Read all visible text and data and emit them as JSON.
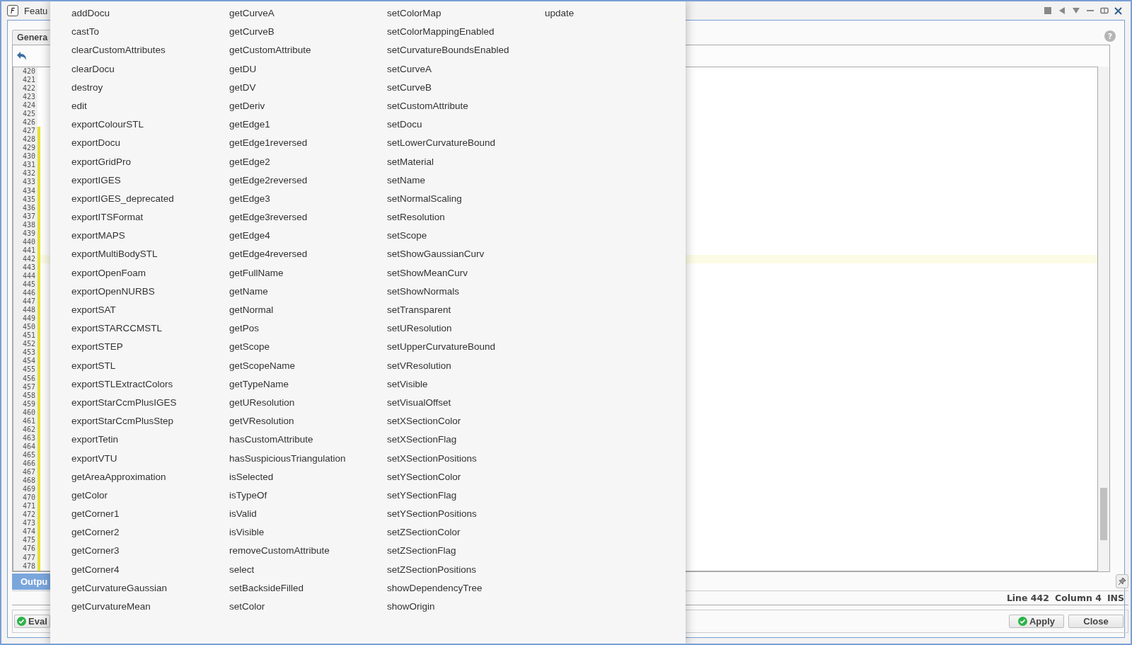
{
  "window": {
    "icon_letter": "F",
    "title": "Featu"
  },
  "tabs": [
    {
      "label": "Genera",
      "selected": true
    }
  ],
  "help": {
    "glyph": "?"
  },
  "editor": {
    "lines": [
      {
        "number": "420",
        "modified": false,
        "current": false
      },
      {
        "number": "421",
        "modified": false,
        "current": false
      },
      {
        "number": "422",
        "modified": false,
        "current": false
      },
      {
        "number": "423",
        "modified": false,
        "current": false
      },
      {
        "number": "424",
        "modified": false,
        "current": false
      },
      {
        "number": "425",
        "modified": false,
        "current": false
      },
      {
        "number": "426",
        "modified": false,
        "current": false
      },
      {
        "number": "427",
        "modified": true,
        "current": false
      },
      {
        "number": "428",
        "modified": true,
        "current": false
      },
      {
        "number": "429",
        "modified": true,
        "current": false
      },
      {
        "number": "430",
        "modified": true,
        "current": false
      },
      {
        "number": "431",
        "modified": true,
        "current": false
      },
      {
        "number": "432",
        "modified": true,
        "current": false
      },
      {
        "number": "433",
        "modified": true,
        "current": false
      },
      {
        "number": "434",
        "modified": true,
        "current": false
      },
      {
        "number": "435",
        "modified": true,
        "current": false
      },
      {
        "number": "436",
        "modified": true,
        "current": false
      },
      {
        "number": "437",
        "modified": true,
        "current": false
      },
      {
        "number": "438",
        "modified": true,
        "current": false
      },
      {
        "number": "439",
        "modified": true,
        "current": false
      },
      {
        "number": "440",
        "modified": true,
        "current": false
      },
      {
        "number": "441",
        "modified": true,
        "current": false
      },
      {
        "number": "442",
        "modified": true,
        "current": true
      },
      {
        "number": "443",
        "modified": true,
        "current": false
      },
      {
        "number": "444",
        "modified": true,
        "current": false
      },
      {
        "number": "445",
        "modified": true,
        "current": false
      },
      {
        "number": "446",
        "modified": true,
        "current": false
      },
      {
        "number": "447",
        "modified": true,
        "current": false
      },
      {
        "number": "448",
        "modified": true,
        "current": false
      },
      {
        "number": "449",
        "modified": true,
        "current": false
      },
      {
        "number": "450",
        "modified": true,
        "current": false
      },
      {
        "number": "451",
        "modified": true,
        "current": false
      },
      {
        "number": "452",
        "modified": true,
        "current": false
      },
      {
        "number": "453",
        "modified": true,
        "current": false
      },
      {
        "number": "454",
        "modified": true,
        "current": false
      },
      {
        "number": "455",
        "modified": true,
        "current": false
      },
      {
        "number": "456",
        "modified": true,
        "current": false
      },
      {
        "number": "457",
        "modified": true,
        "current": false
      },
      {
        "number": "458",
        "modified": true,
        "current": false
      },
      {
        "number": "459",
        "modified": true,
        "current": false
      },
      {
        "number": "460",
        "modified": true,
        "current": false
      },
      {
        "number": "461",
        "modified": true,
        "current": false
      },
      {
        "number": "462",
        "modified": true,
        "current": false
      },
      {
        "number": "463",
        "modified": true,
        "current": false
      },
      {
        "number": "464",
        "modified": true,
        "current": false
      },
      {
        "number": "465",
        "modified": true,
        "current": false
      },
      {
        "number": "466",
        "modified": true,
        "current": false
      },
      {
        "number": "467",
        "modified": true,
        "current": false
      },
      {
        "number": "468",
        "modified": true,
        "current": false
      },
      {
        "number": "469",
        "modified": true,
        "current": false
      },
      {
        "number": "470",
        "modified": true,
        "current": false
      },
      {
        "number": "471",
        "modified": true,
        "current": false
      },
      {
        "number": "472",
        "modified": true,
        "current": false
      },
      {
        "number": "473",
        "modified": true,
        "current": false
      },
      {
        "number": "474",
        "modified": true,
        "current": false
      },
      {
        "number": "475",
        "modified": true,
        "current": false
      },
      {
        "number": "476",
        "modified": true,
        "current": false
      },
      {
        "number": "477",
        "modified": true,
        "current": false
      },
      {
        "number": "478",
        "modified": true,
        "current": false
      }
    ]
  },
  "output_tab": {
    "label": "Outpu",
    "selected": true
  },
  "status_bar": {
    "line": "Line 442",
    "column": "Column 4",
    "mode": "INS"
  },
  "buttons": [
    {
      "label": "Eval",
      "kind": "left"
    },
    {
      "label": "Apply",
      "kind": "apply"
    },
    {
      "label": "Close",
      "kind": "plain"
    }
  ],
  "completion_popup": {
    "items": [
      "addDocu",
      "castTo",
      "clearCustomAttributes",
      "clearDocu",
      "destroy",
      "edit",
      "exportColourSTL",
      "exportDocu",
      "exportGridPro",
      "exportIGES",
      "exportIGES_deprecated",
      "exportITSFormat",
      "exportMAPS",
      "exportMultiBodySTL",
      "exportOpenFoam",
      "exportOpenNURBS",
      "exportSAT",
      "exportSTARCCMSTL",
      "exportSTEP",
      "exportSTL",
      "exportSTLExtractColors",
      "exportStarCcmPlusIGES",
      "exportStarCcmPlusStep",
      "exportTetin",
      "exportVTU",
      "getAreaApproximation",
      "getColor",
      "getCorner1",
      "getCorner2",
      "getCorner3",
      "getCorner4",
      "getCurvatureGaussian",
      "getCurvatureMean",
      "getCurveA",
      "getCurveB",
      "getCustomAttribute",
      "getDU",
      "getDV",
      "getDeriv",
      "getEdge1",
      "getEdge1reversed",
      "getEdge2",
      "getEdge2reversed",
      "getEdge3",
      "getEdge3reversed",
      "getEdge4",
      "getEdge4reversed",
      "getFullName",
      "getName",
      "getNormal",
      "getPos",
      "getScope",
      "getScopeName",
      "getTypeName",
      "getUResolution",
      "getVResolution",
      "hasCustomAttribute",
      "hasSuspiciousTriangulation",
      "isSelected",
      "isTypeOf",
      "isValid",
      "isVisible",
      "removeCustomAttribute",
      "select",
      "setBacksideFilled",
      "setColor",
      "setColorMap",
      "setColorMappingEnabled",
      "setCurvatureBoundsEnabled",
      "setCurveA",
      "setCurveB",
      "setCustomAttribute",
      "setDocu",
      "setLowerCurvatureBound",
      "setMaterial",
      "setName",
      "setNormalScaling",
      "setResolution",
      "setScope",
      "setShowGaussianCurv",
      "setShowMeanCurv",
      "setShowNormals",
      "setTransparent",
      "setUResolution",
      "setUpperCurvatureBound",
      "setVResolution",
      "setVisible",
      "setVisualOffset",
      "setXSectionColor",
      "setXSectionFlag",
      "setXSectionPositions",
      "setYSectionColor",
      "setYSectionFlag",
      "setYSectionPositions",
      "setZSectionColor",
      "setZSectionFlag",
      "setZSectionPositions",
      "showDependencyTree",
      "showOrigin",
      "update"
    ]
  }
}
